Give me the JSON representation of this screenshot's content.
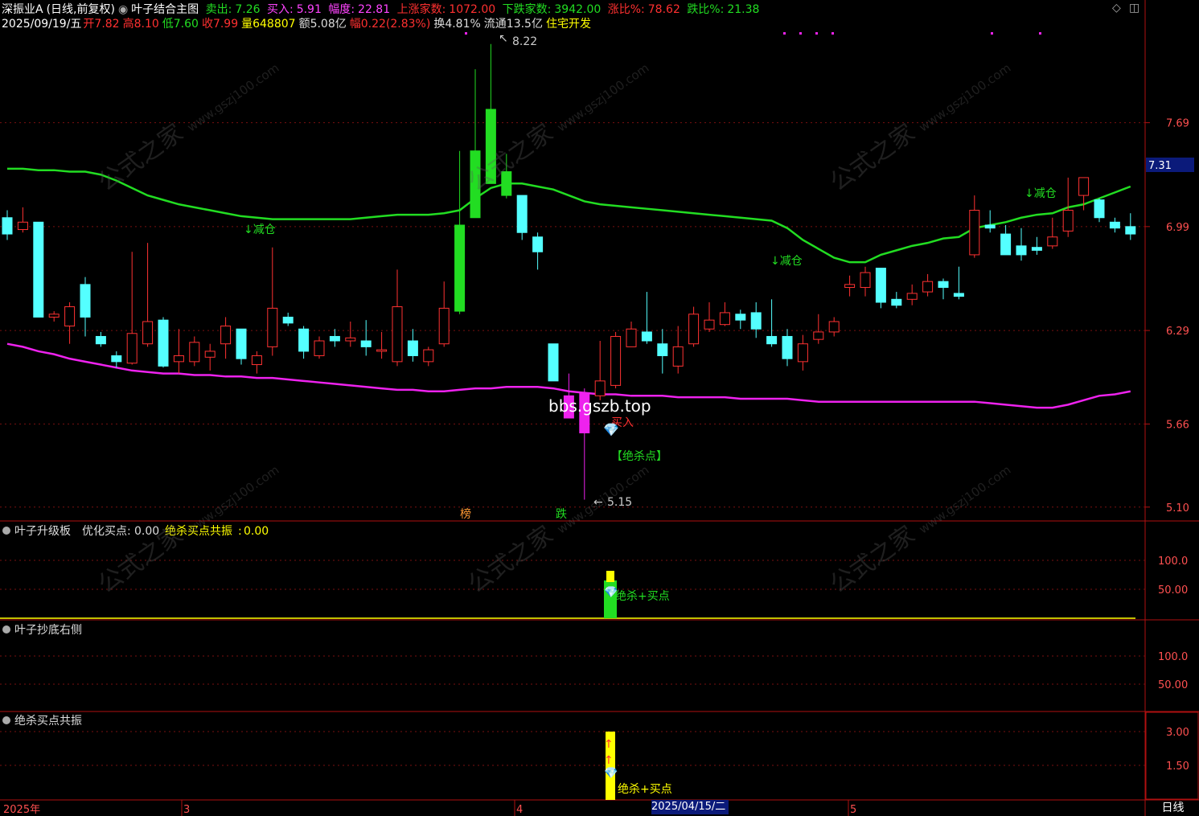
{
  "header": {
    "stock_name": "深振业A",
    "mode": "(日线,前复权)",
    "indicator_main": "叶子结合主图",
    "sell_label": "卖出",
    "sell_value": "7.26",
    "buy_label": "买入",
    "buy_value": "5.91",
    "amplitude_label": "幅度",
    "amplitude_value": "22.81",
    "up_count_label": "上涨家数",
    "up_count_value": "1072.00",
    "down_count_label": "下跌家数",
    "down_count_value": "3942.00",
    "up_ratio_label": "涨比%",
    "up_ratio_value": "78.62",
    "down_ratio_label": "跌比%",
    "down_ratio_value": "21.38"
  },
  "ohlc_bar": {
    "date": "2025/09/19/五",
    "open_label": "开",
    "open": "7.82",
    "high_label": "高",
    "high": "8.10",
    "low_label": "低",
    "low": "7.60",
    "close_label": "收",
    "close": "7.99",
    "vol_label": "量",
    "vol": "648807",
    "amt_label": "额",
    "amt": "5.08亿",
    "chg_label": "幅",
    "chg": "0.22(2.83%)",
    "turn_label": "换",
    "turn": "4.81%",
    "float_label": "流通",
    "float": "13.5亿",
    "sector": "住宅开发"
  },
  "colors": {
    "bg": "#000000",
    "up": "#ff3232",
    "down": "#54ffff",
    "upper_band": "#22dd22",
    "lower_band": "#ee22ee",
    "axis_text": "#ff5050",
    "grid": "#7a1010",
    "label_green": "#22dd22",
    "label_yellow": "#ffff00"
  },
  "chart_data": {
    "type": "candlestick",
    "y_ticks": [
      7.69,
      6.99,
      6.29,
      5.66,
      5.1
    ],
    "last_price_tag": "7.31",
    "high_marker": "8.22",
    "low_marker": "5.15",
    "ylim": [
      5.05,
      8.3
    ],
    "candles": [
      [
        7.05,
        6.94,
        7.1,
        6.9
      ],
      [
        6.97,
        7.02,
        7.12,
        6.95
      ],
      [
        7.02,
        6.38,
        7.02,
        6.38
      ],
      [
        6.38,
        6.4,
        6.42,
        6.35
      ],
      [
        6.32,
        6.45,
        6.48,
        6.2
      ],
      [
        6.6,
        6.38,
        6.65,
        6.25
      ],
      [
        6.25,
        6.2,
        6.28,
        6.18
      ],
      [
        6.12,
        6.08,
        6.15,
        6.04
      ],
      [
        6.07,
        6.27,
        6.82,
        6.06
      ],
      [
        6.2,
        6.35,
        6.88,
        6.18
      ],
      [
        6.36,
        6.05,
        6.38,
        6.04
      ],
      [
        6.08,
        6.12,
        6.3,
        6.0
      ],
      [
        6.08,
        6.21,
        6.25,
        6.05
      ],
      [
        6.11,
        6.15,
        6.2,
        6.02
      ],
      [
        6.2,
        6.32,
        6.38,
        6.1
      ],
      [
        6.3,
        6.1,
        6.3,
        6.06
      ],
      [
        6.06,
        6.12,
        6.15,
        6.0
      ],
      [
        6.18,
        6.44,
        6.85,
        6.12
      ],
      [
        6.38,
        6.34,
        6.41,
        6.32
      ],
      [
        6.3,
        6.15,
        6.32,
        6.1
      ],
      [
        6.12,
        6.22,
        6.25,
        6.1
      ],
      [
        6.25,
        6.22,
        6.3,
        6.18
      ],
      [
        6.22,
        6.24,
        6.35,
        6.18
      ],
      [
        6.22,
        6.18,
        6.36,
        6.12
      ],
      [
        6.15,
        6.16,
        6.28,
        6.1
      ],
      [
        6.08,
        6.45,
        6.7,
        6.05
      ],
      [
        6.22,
        6.12,
        6.3,
        6.08
      ],
      [
        6.08,
        6.16,
        6.18,
        6.05
      ],
      [
        6.2,
        6.44,
        6.62,
        6.18
      ],
      [
        6.42,
        7.0,
        7.5,
        6.4
      ],
      [
        7.05,
        7.5,
        8.05,
        7.05
      ],
      [
        7.28,
        7.78,
        8.22,
        7.28
      ],
      [
        7.36,
        7.2,
        7.48,
        7.18
      ],
      [
        7.2,
        6.95,
        7.2,
        6.9
      ],
      [
        6.92,
        6.82,
        6.95,
        6.7
      ],
      [
        6.2,
        5.95,
        6.2,
        5.95
      ],
      [
        5.85,
        5.7,
        6.0,
        5.7
      ],
      [
        5.87,
        5.6,
        5.9,
        5.15
      ],
      [
        5.85,
        5.95,
        6.22,
        5.82
      ],
      [
        5.92,
        6.25,
        6.28,
        5.9
      ],
      [
        6.18,
        6.3,
        6.35,
        6.18
      ],
      [
        6.28,
        6.22,
        6.55,
        6.2
      ],
      [
        6.2,
        6.12,
        6.3,
        6.0
      ],
      [
        6.05,
        6.18,
        6.32,
        6.0
      ],
      [
        6.2,
        6.4,
        6.45,
        6.18
      ],
      [
        6.3,
        6.36,
        6.48,
        6.28
      ],
      [
        6.33,
        6.41,
        6.48,
        6.32
      ],
      [
        6.4,
        6.36,
        6.43,
        6.3
      ],
      [
        6.41,
        6.3,
        6.48,
        6.24
      ],
      [
        6.25,
        6.2,
        6.5,
        6.18
      ],
      [
        6.25,
        6.1,
        6.3,
        6.05
      ],
      [
        6.08,
        6.2,
        6.26,
        6.02
      ],
      [
        6.23,
        6.28,
        6.4,
        6.2
      ],
      [
        6.28,
        6.35,
        6.38,
        6.25
      ],
      [
        6.58,
        6.6,
        6.66,
        6.52
      ],
      [
        6.58,
        6.68,
        6.72,
        6.52
      ],
      [
        6.71,
        6.48,
        6.71,
        6.44
      ],
      [
        6.5,
        6.46,
        6.55,
        6.44
      ],
      [
        6.5,
        6.54,
        6.6,
        6.46
      ],
      [
        6.55,
        6.62,
        6.67,
        6.52
      ],
      [
        6.62,
        6.58,
        6.64,
        6.5
      ],
      [
        6.54,
        6.52,
        6.72,
        6.5
      ],
      [
        6.8,
        7.1,
        7.2,
        6.78
      ],
      [
        7.0,
        6.98,
        7.1,
        6.95
      ],
      [
        6.94,
        6.8,
        7.0,
        6.8
      ],
      [
        6.86,
        6.8,
        6.98,
        6.76
      ],
      [
        6.85,
        6.83,
        6.92,
        6.8
      ],
      [
        6.86,
        6.92,
        7.05,
        6.84
      ],
      [
        6.96,
        7.1,
        7.32,
        6.92
      ],
      [
        7.2,
        7.32,
        7.32,
        7.1
      ],
      [
        7.17,
        7.05,
        7.18,
        7.02
      ],
      [
        7.02,
        6.98,
        7.05,
        6.95
      ],
      [
        6.99,
        6.94,
        7.08,
        6.9
      ]
    ],
    "upper_band": [
      7.38,
      7.38,
      7.37,
      7.37,
      7.36,
      7.36,
      7.34,
      7.3,
      7.25,
      7.2,
      7.17,
      7.14,
      7.12,
      7.1,
      7.08,
      7.06,
      7.05,
      7.04,
      7.04,
      7.04,
      7.04,
      7.04,
      7.04,
      7.05,
      7.06,
      7.07,
      7.07,
      7.07,
      7.08,
      7.1,
      7.18,
      7.25,
      7.28,
      7.28,
      7.26,
      7.24,
      7.2,
      7.16,
      7.14,
      7.13,
      7.12,
      7.11,
      7.1,
      7.09,
      7.08,
      7.07,
      7.06,
      7.05,
      7.04,
      7.03,
      6.98,
      6.9,
      6.84,
      6.78,
      6.75,
      6.75,
      6.8,
      6.83,
      6.86,
      6.88,
      6.91,
      6.92,
      6.98,
      7.0,
      7.02,
      7.05,
      7.07,
      7.08,
      7.12,
      7.14,
      7.18,
      7.22,
      7.26
    ],
    "lower_band": [
      6.2,
      6.18,
      6.15,
      6.13,
      6.1,
      6.08,
      6.06,
      6.04,
      6.02,
      6.01,
      6.0,
      6.0,
      5.99,
      5.99,
      5.98,
      5.98,
      5.97,
      5.97,
      5.96,
      5.95,
      5.94,
      5.93,
      5.92,
      5.91,
      5.9,
      5.89,
      5.89,
      5.88,
      5.88,
      5.89,
      5.9,
      5.9,
      5.91,
      5.91,
      5.91,
      5.9,
      5.88,
      5.87,
      5.86,
      5.86,
      5.85,
      5.85,
      5.85,
      5.84,
      5.84,
      5.84,
      5.84,
      5.83,
      5.83,
      5.83,
      5.83,
      5.82,
      5.81,
      5.81,
      5.81,
      5.81,
      5.81,
      5.81,
      5.81,
      5.81,
      5.81,
      5.81,
      5.81,
      5.8,
      5.79,
      5.78,
      5.77,
      5.77,
      5.79,
      5.82,
      5.85,
      5.86,
      5.88
    ]
  },
  "annotations": {
    "reduce1": "↓减仓",
    "reduce2": "↓减仓",
    "reduce3": "↓减仓",
    "buy_mark": "买入",
    "kill_point": "【绝杀点】",
    "site": "bbs.gszb.top",
    "tag_bang": "榜",
    "tag_die": "跌"
  },
  "panel1": {
    "title": "叶子升级板",
    "metric1_label": "优化买点",
    "metric1_value": "0.00",
    "metric2_label": "绝杀买点共振",
    "metric2_value": "0.00",
    "ticks": [
      "100.0",
      "50.00"
    ],
    "signal_label": "绝杀+买点"
  },
  "panel2": {
    "title": "叶子抄底右侧",
    "ticks": [
      "100.0",
      "50.00"
    ]
  },
  "panel3": {
    "title": "绝杀买点共振",
    "ticks": [
      "3.00",
      "1.50"
    ],
    "signal_label": "绝杀+买点"
  },
  "x_axis": {
    "labels": [
      "2025年",
      "3",
      "4",
      "5"
    ],
    "cursor_date": "2025/04/15/二",
    "period": "日线"
  },
  "watermark": {
    "text": "公式之家",
    "url": "www.gszj100.com"
  }
}
